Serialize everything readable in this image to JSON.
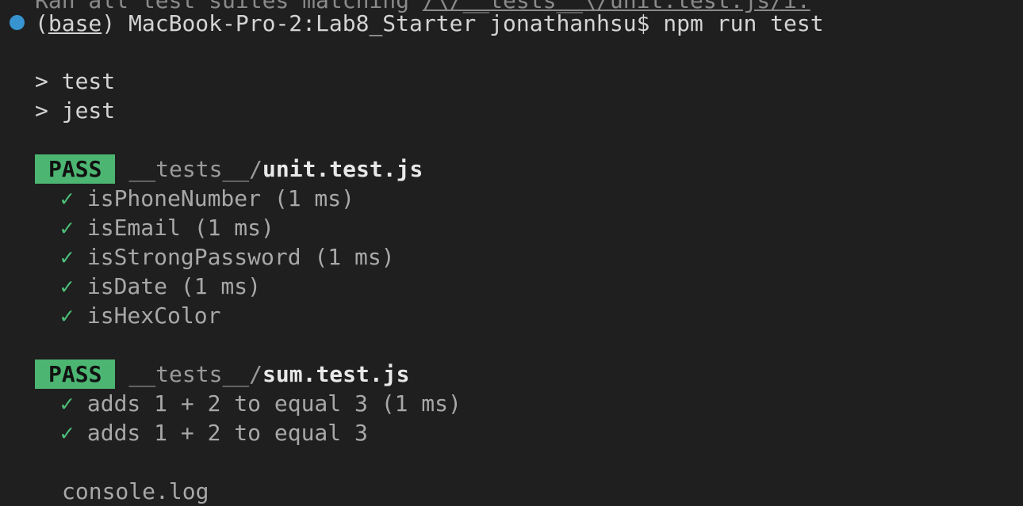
{
  "colors": {
    "background": "#1f1f1f",
    "pass_badge": "#4cb572",
    "check": "#4cc27a",
    "status_dot": "#3794d0"
  },
  "cutoff_line": {
    "pre": "Ran all test suites matching ",
    "path": "/\\/__tests__\\/unit.test.js/i."
  },
  "prompt": {
    "open_paren": "(",
    "env": "base",
    "rest": ") MacBook-Pro-2:Lab8_Starter jonathanhsu$ npm run test"
  },
  "script_lines": [
    "> test",
    "> jest"
  ],
  "suites": [
    {
      "status": "PASS",
      "dir": "__tests__/",
      "file": "unit.test.js",
      "tests": [
        {
          "check": "✓",
          "text": "isPhoneNumber (1 ms)"
        },
        {
          "check": "✓",
          "text": "isEmail (1 ms)"
        },
        {
          "check": "✓",
          "text": "isStrongPassword (1 ms)"
        },
        {
          "check": "✓",
          "text": "isDate (1 ms)"
        },
        {
          "check": "✓",
          "text": "isHexColor"
        }
      ]
    },
    {
      "status": "PASS",
      "dir": "__tests__/",
      "file": "sum.test.js",
      "tests": [
        {
          "check": "✓",
          "text": "adds 1 + 2 to equal 3 (1 ms)"
        },
        {
          "check": "✓",
          "text": "adds 1 + 2 to equal 3"
        }
      ]
    }
  ],
  "console_log_label": "console.log"
}
